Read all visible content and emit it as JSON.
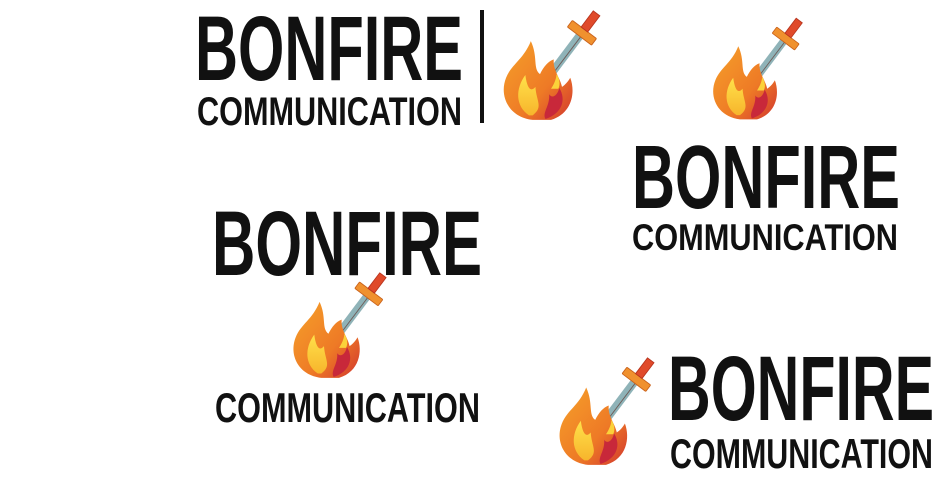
{
  "brand": {
    "name": "BONFIRE",
    "tagline": "COMMUNICATION"
  },
  "colors": {
    "text": "#111111",
    "flame_orange": "#f08a24",
    "flame_yellow": "#fbd23a",
    "flame_red": "#c8283a",
    "blade": "#8fb3b8",
    "guard": "#f0912e",
    "handle": "#e04a2a"
  },
  "icons": {
    "logo_mark": "flaming-sword-icon"
  },
  "variants": [
    {
      "layout": "horizontal-with-divider",
      "name": "BONFIRE",
      "tagline": "COMMUNICATION"
    },
    {
      "layout": "icon-above",
      "name": "BONFIRE",
      "tagline": "COMMUNICATION"
    },
    {
      "layout": "icon-between",
      "name": "BONFIRE",
      "tagline": "COMMUNICATION"
    },
    {
      "layout": "icon-left",
      "name": "BONFIRE",
      "tagline": "COMMUNICATION"
    }
  ]
}
